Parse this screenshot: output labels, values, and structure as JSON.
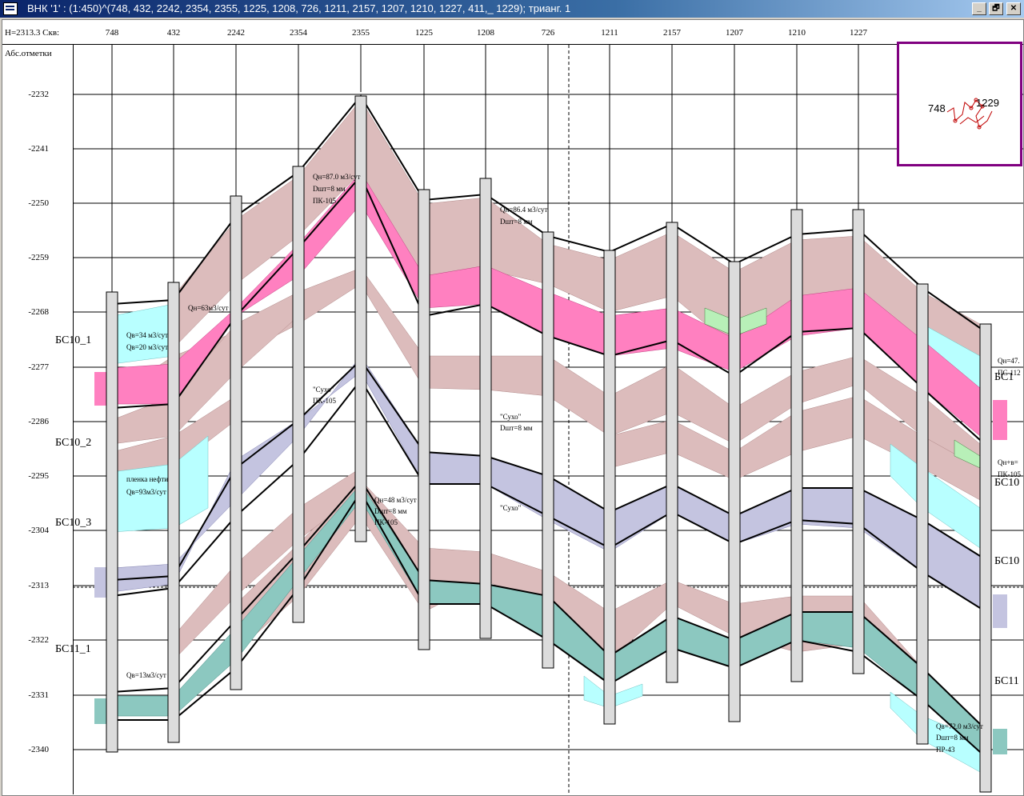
{
  "window": {
    "title": "ВНК '1' : (1:450)^(748, 432, 2242, 2354, 2355, 1225, 1208, 726, 1211, 2157, 1207, 1210, 1227, 411,_ 1229); трианг. 1",
    "buttons": [
      "_",
      "🗗",
      "✕"
    ]
  },
  "header": {
    "label": "Н=2313.3 Скв:",
    "wells": [
      "748",
      "432",
      "2242",
      "2354",
      "2355",
      "1225",
      "1208",
      "726",
      "1211",
      "2157",
      "1207",
      "1210",
      "1227"
    ]
  },
  "axis": {
    "title": "Абс.отметки",
    "ticks": [
      "-2232",
      "-2241",
      "-2250",
      "-2259",
      "-2268",
      "-2277",
      "-2286",
      "-2295",
      "-2304",
      "-2313",
      "-2322",
      "-2331",
      "-2340"
    ]
  },
  "layers": [
    "БС10_1",
    "БС10_2",
    "БС10_3",
    "БС11_1"
  ],
  "right_labels": [
    "БС1",
    "БС10",
    "БС10",
    "БС11"
  ],
  "annotations": [
    "Qн=63м3/сут",
    "Qв=34 м3/сут",
    "Qв=20 м3/сут",
    "пленка нефти",
    "Qв=93м3/сут",
    "Qв=13м3/сут",
    "Qн=87.0 м3/сут",
    "Dшт=8 мм",
    "ПК-105",
    "\"Сухо\"",
    "ПК-105",
    "Qн=48 м3/сут",
    "Dшт=8 мм",
    "ПК-105",
    "Qн=86.4 м3/сут",
    "Dшт=8 мм",
    "\"Сухо\"",
    "Dшт=8 мм",
    "\"Сухо\"",
    "Qн=47.",
    "ПС-112",
    "Qн+в=",
    "ПК-105",
    "Qв=72.0 м3/сут",
    "Dшт=8 мм",
    "ПР-43"
  ],
  "inset": {
    "left": "748",
    "right": "1229"
  },
  "colors": {
    "oil": "#ff80c0",
    "water": "#b8ffff",
    "tan": "#dcbcbc",
    "lavender": "#c4c4e0",
    "teal": "#8cc8c0",
    "green": "#b8f0b8",
    "frame": "#800080"
  }
}
